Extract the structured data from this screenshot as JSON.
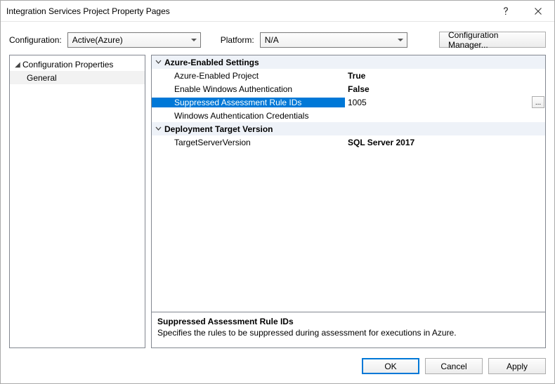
{
  "title": "Integration Services Project Property Pages",
  "config_row": {
    "config_label": "Configuration:",
    "config_value": "Active(Azure)",
    "platform_label": "Platform:",
    "platform_value": "N/A",
    "manager_btn": "Configuration Manager..."
  },
  "tree": {
    "root": "Configuration Properties",
    "child": "General"
  },
  "grid": {
    "cat1": "Azure-Enabled Settings",
    "rows1": [
      {
        "name": "Azure-Enabled Project",
        "value": "True",
        "bold": true
      },
      {
        "name": "Enable Windows Authentication",
        "value": "False",
        "bold": true
      },
      {
        "name": "Suppressed Assessment Rule IDs",
        "value": "1005",
        "bold": false,
        "selected": true
      },
      {
        "name": "Windows Authentication Credentials",
        "value": "",
        "bold": false
      }
    ],
    "cat2": "Deployment Target Version",
    "rows2": [
      {
        "name": "TargetServerVersion",
        "value": "SQL Server 2017",
        "bold": true
      }
    ]
  },
  "desc": {
    "title": "Suppressed Assessment Rule IDs",
    "body": "Specifies the rules to be suppressed during assessment for executions in Azure."
  },
  "buttons": {
    "ok": "OK",
    "cancel": "Cancel",
    "apply": "Apply"
  },
  "ellipsis": "..."
}
